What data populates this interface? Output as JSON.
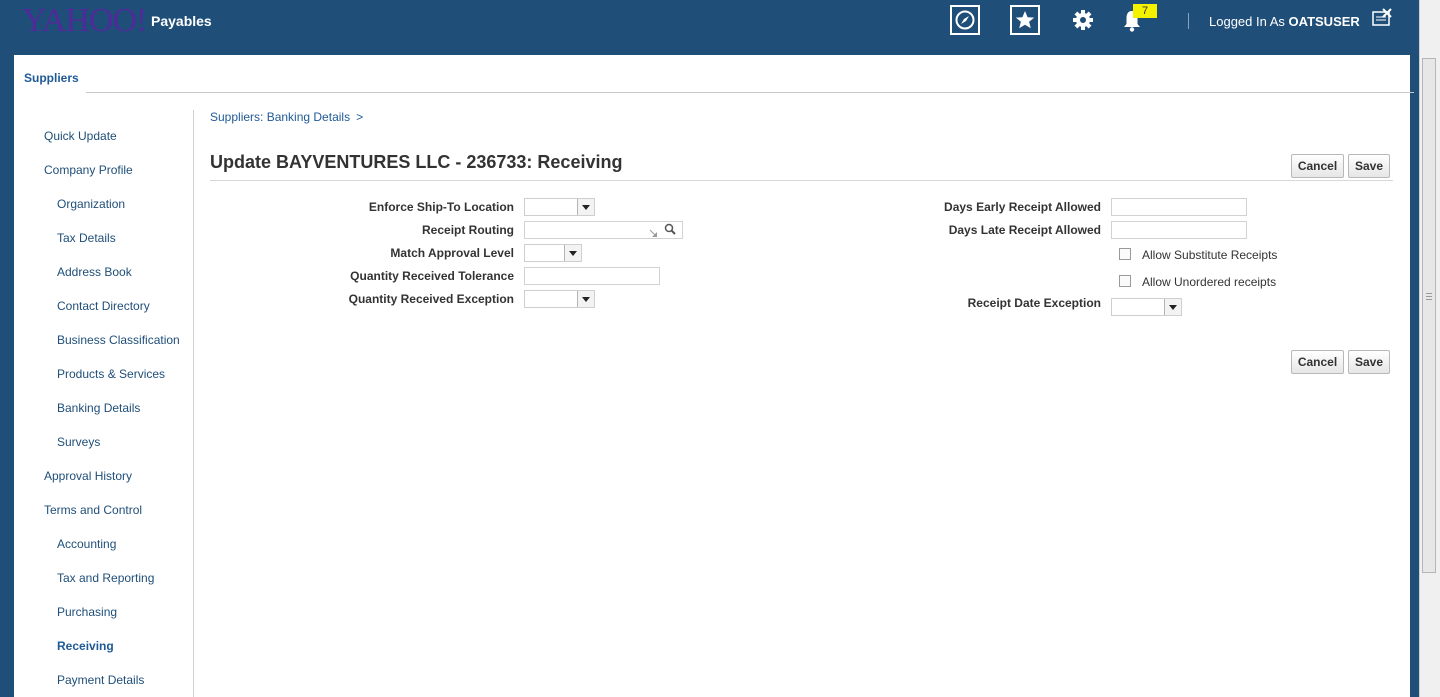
{
  "header": {
    "logo": "YAHOO!",
    "app_title": "Payables",
    "notification_count": "7",
    "logged_in_prefix": "Logged In As",
    "username": "OATSUSER",
    "icons": [
      "compass-icon",
      "favorites-star-icon",
      "settings-gear-icon",
      "notifications-bell-icon",
      "window-close-icon"
    ]
  },
  "tabs": {
    "suppliers": "Suppliers"
  },
  "nav": {
    "items": [
      {
        "label": "Quick Update"
      },
      {
        "label": "Company Profile"
      },
      {
        "label": "Organization"
      },
      {
        "label": "Tax Details"
      },
      {
        "label": "Address Book"
      },
      {
        "label": "Contact Directory"
      },
      {
        "label": "Business Classification"
      },
      {
        "label": "Products & Services"
      },
      {
        "label": "Banking Details"
      },
      {
        "label": "Surveys"
      },
      {
        "label": "Approval History"
      },
      {
        "label": "Terms and Control"
      },
      {
        "label": "Accounting"
      },
      {
        "label": "Tax and Reporting"
      },
      {
        "label": "Purchasing"
      },
      {
        "label": "Receiving"
      },
      {
        "label": "Payment Details"
      }
    ],
    "active": "Receiving"
  },
  "breadcrumb": {
    "item": "Suppliers: Banking Details",
    "separator": ">"
  },
  "page": {
    "title": "Update BAYVENTURES LLC - 236733: Receiving",
    "cancel_label": "Cancel",
    "save_label": "Save"
  },
  "form": {
    "left": {
      "enforce_ship_to_label": "Enforce Ship-To Location",
      "enforce_ship_to_value": "",
      "receipt_routing_label": "Receipt Routing",
      "receipt_routing_value": "",
      "match_approval_label": "Match Approval Level",
      "match_approval_value": "",
      "qty_tolerance_label": "Quantity Received Tolerance",
      "qty_tolerance_value": "",
      "qty_exception_label": "Quantity Received Exception",
      "qty_exception_value": ""
    },
    "right": {
      "days_early_label": "Days Early Receipt Allowed",
      "days_early_value": "",
      "days_late_label": "Days Late Receipt Allowed",
      "days_late_value": "",
      "allow_substitute_label": "Allow Substitute Receipts",
      "allow_substitute_checked": false,
      "allow_unordered_label": "Allow Unordered receipts",
      "allow_unordered_checked": false,
      "receipt_date_exception_label": "Receipt Date Exception",
      "receipt_date_exception_value": ""
    }
  }
}
